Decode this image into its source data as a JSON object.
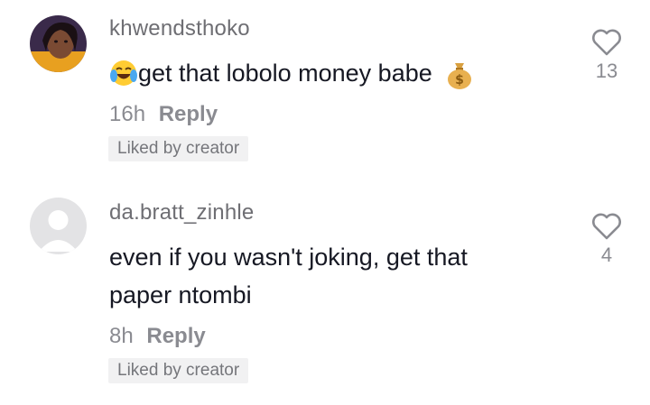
{
  "comments": [
    {
      "username": "khwendsthoko",
      "text": "get that lobolo money babe",
      "time": "16h",
      "reply_label": "Reply",
      "badge": "Liked by creator",
      "likes": "13",
      "emoji_start": "tears-of-joy-emoji",
      "emoji_end": "money-bag-emoji"
    },
    {
      "username": "da.bratt_zinhle",
      "text_line1": "even if you wasn't joking, get that",
      "text_line2": "paper ntombi",
      "time": "8h",
      "reply_label": "Reply",
      "badge": "Liked by creator",
      "likes": "4"
    }
  ]
}
